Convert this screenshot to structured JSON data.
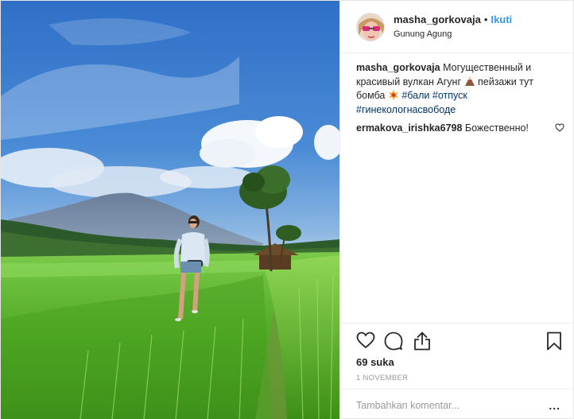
{
  "post": {
    "username": "masha_gorkovaja",
    "separator": "•",
    "follow_label": "Ikuti",
    "location": "Gunung Agung"
  },
  "comments": [
    {
      "user": "masha_gorkovaja",
      "text_1": "Могущественный и красивый вулкан Агунг",
      "emoji_1": "volcano-emoji",
      "text_2": "пейзажи тут бомба",
      "emoji_2": "collision-emoji",
      "tags": [
        "#бали",
        "#отпуск",
        "#гинекологнасвободе"
      ]
    },
    {
      "user": "ermakova_irishka6798",
      "text": "Божественно!"
    }
  ],
  "actions": {
    "like_icon": "heart-icon",
    "comment_icon": "comment-icon",
    "share_icon": "share-icon",
    "save_icon": "bookmark-icon"
  },
  "likes": "69 suka",
  "date": "1 NOVEMBER",
  "add_comment": {
    "placeholder": "Tambahkan komentar...",
    "more_label": "..."
  },
  "colors": {
    "link_blue": "#3897f0",
    "hashtag": "#003569",
    "muted": "#999999"
  }
}
